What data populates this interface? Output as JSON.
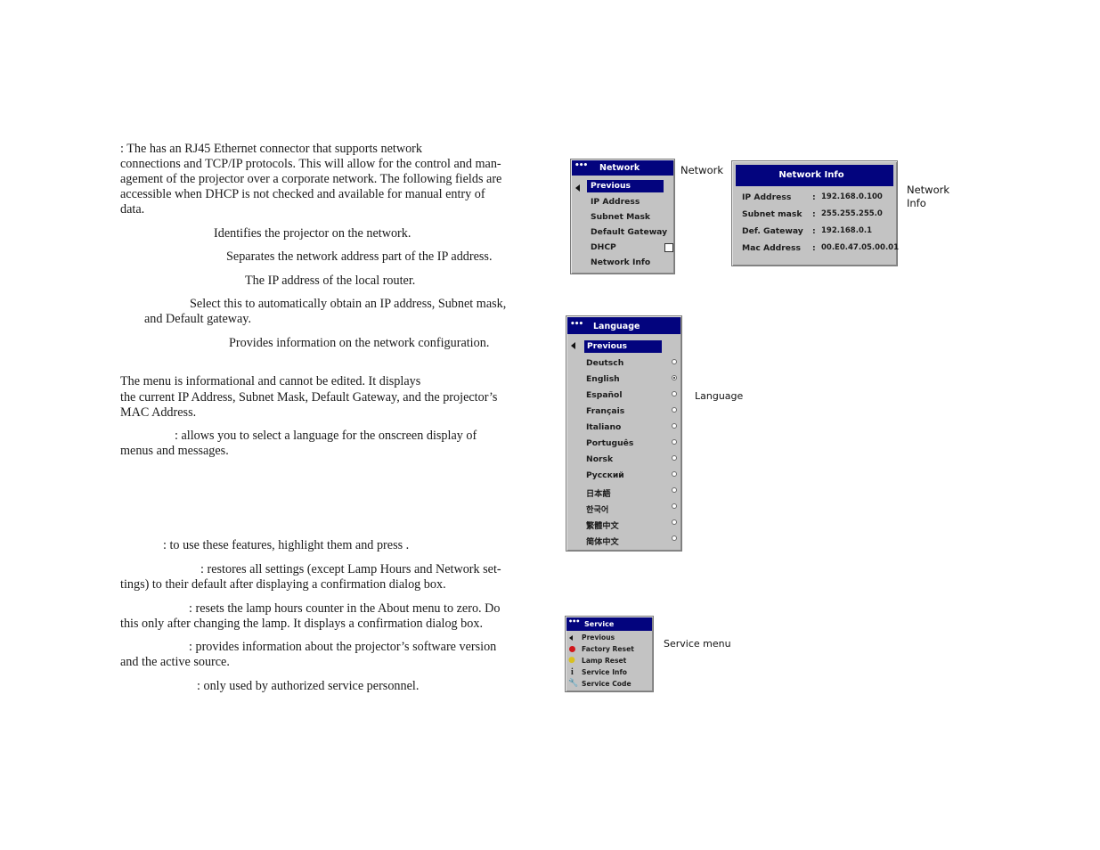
{
  "text": {
    "network_intro": [
      ": The         has an RJ45 Ethernet connector that supports network",
      "connections and TCP/IP protocols. This will allow for the control and man-",
      "agement of the projector over a corporate network. The following fields are",
      "accessible when DHCP is not checked and available for manual entry of",
      "data."
    ],
    "ip_address_desc": "Identifies the projector on the network.",
    "subnet_desc": "Separates the network address part of the IP address.",
    "gateway_desc": "The IP address of the local router.",
    "dhcp_desc": [
      "Select this to automatically obtain an IP address, Subnet mask,",
      "and Default gateway."
    ],
    "netinfo_desc": "Provides information on the network configuration.",
    "netinfo_para": [
      "The                          menu is informational and cannot be edited. It displays",
      "the current IP Address, Subnet Mask, Default Gateway, and the projector’s",
      "MAC Address."
    ],
    "language_para": [
      ": allows you to select a language for the onscreen display of",
      "menus and messages."
    ],
    "service_intro": ": to use these features, highlight them and press           .",
    "factory_reset": [
      ": restores all settings (except Lamp Hours and Network set-",
      "tings) to their default after displaying a confirmation dialog box."
    ],
    "lamp_reset": [
      ": resets the lamp hours counter in the About menu to zero. Do",
      "this only after changing the lamp. It displays a confirmation dialog box."
    ],
    "service_info": [
      ": provides information about the projector’s software version",
      "and the active source."
    ],
    "service_code": ": only used by authorized service personnel."
  },
  "network_menu": {
    "dots": "•••",
    "title": "Network",
    "items": [
      "Previous",
      "IP Address",
      "Subnet Mask",
      "Default Gateway",
      "DHCP",
      "Network Info"
    ],
    "dhcp_checked": false,
    "caption": "Network"
  },
  "network_info": {
    "title": "Network Info",
    "rows": [
      {
        "label": "IP Address",
        "sep": ":",
        "value": "192.168.0.100"
      },
      {
        "label": "Subnet mask",
        "sep": ":",
        "value": "255.255.255.0"
      },
      {
        "label": "Def. Gateway",
        "sep": ":",
        "value": "192.168.0.1"
      },
      {
        "label": "Mac Address",
        "sep": ":",
        "value": "00.E0.47.05.00.01"
      }
    ],
    "caption": [
      "Network",
      "Info"
    ]
  },
  "language_menu": {
    "dots": "•••",
    "title": "Language",
    "previous": "Previous",
    "items": [
      "Deutsch",
      "English",
      "Español",
      "Français",
      "Italiano",
      "Português",
      "Norsk",
      "Русский",
      "日本語",
      "한국어",
      "繁體中文",
      "简体中文"
    ],
    "selected": "English",
    "caption": "Language"
  },
  "service_menu": {
    "dots": "•••",
    "title": "Service",
    "items": [
      {
        "label": "Previous",
        "icon": "left-arrow-icon"
      },
      {
        "label": "Factory Reset",
        "icon": "red-dot-icon"
      },
      {
        "label": "Lamp Reset",
        "icon": "lightbulb-icon"
      },
      {
        "label": "Service Info",
        "icon": "info-icon"
      },
      {
        "label": "Service Code",
        "icon": "wrench-icon"
      }
    ],
    "caption": "Service menu"
  }
}
